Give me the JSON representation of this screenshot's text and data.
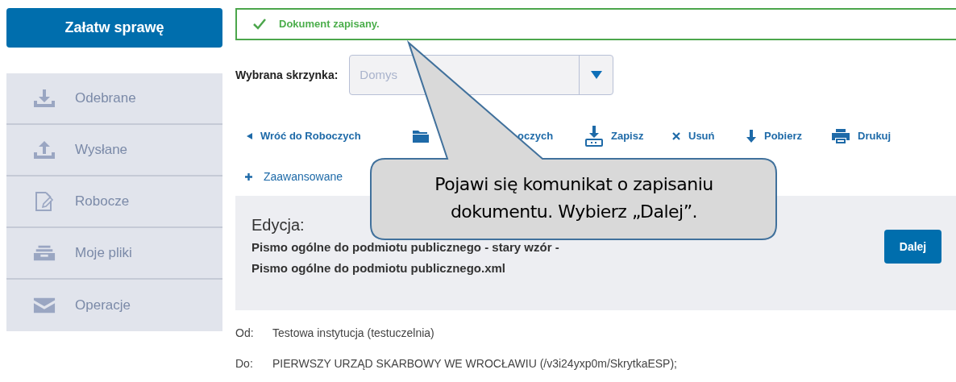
{
  "sidebar": {
    "action_button": "Załatw sprawę",
    "items": [
      {
        "label": "Odebrane",
        "kind": "inbox"
      },
      {
        "label": "Wysłane",
        "kind": "outbox"
      },
      {
        "label": "Robocze",
        "kind": "draft"
      },
      {
        "label": "Moje pliki",
        "kind": "files"
      },
      {
        "label": "Operacje",
        "kind": "mail"
      }
    ]
  },
  "notice": {
    "text": "Dokument zapisany."
  },
  "mailbox": {
    "label": "Wybrana skrzynka:",
    "value": "Domys"
  },
  "toolbar": [
    {
      "label": "Wróć do Roboczych",
      "kind": "back"
    },
    {
      "label": "oczych",
      "kind": "folder"
    },
    {
      "label": "Zapisz",
      "kind": "save"
    },
    {
      "label": "Usuń",
      "kind": "delete"
    },
    {
      "label": "Pobierz",
      "kind": "download"
    },
    {
      "label": "Drukuj",
      "kind": "print"
    }
  ],
  "advanced": {
    "label": "Zaawansowane"
  },
  "edit_panel": {
    "heading": "Edycja:",
    "document": "Pismo ogólne do podmiotu publicznego - stary wzór - Pismo ogólne do podmiotu publicznego.xml",
    "button": "Dalej"
  },
  "details": [
    {
      "label": "Od:",
      "value": "Testowa instytucja (testuczelnia)"
    },
    {
      "label": "Do:",
      "value": "PIERWSZY URZĄD SKARBOWY WE WROCŁAWIU (/v3i24yxp0m/SkrytkaESP);"
    }
  ],
  "callout": {
    "text": "Pojawi się komunikat o zapisaniu dokumentu. Wybierz „Dalej”."
  }
}
